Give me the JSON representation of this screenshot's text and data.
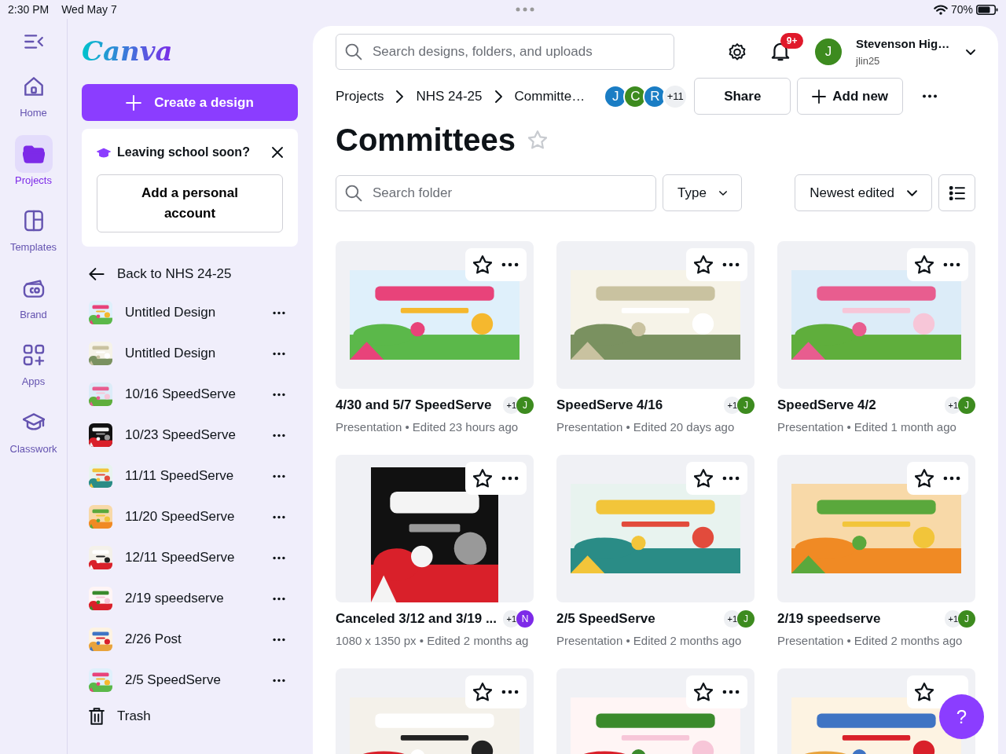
{
  "status_bar": {
    "time": "2:30 PM",
    "date": "Wed May 7",
    "battery": "70%"
  },
  "rail": {
    "items": [
      {
        "label": "Home",
        "selected": false
      },
      {
        "label": "Projects",
        "selected": true
      },
      {
        "label": "Templates",
        "selected": false
      },
      {
        "label": "Brand",
        "selected": false
      },
      {
        "label": "Apps",
        "selected": false
      },
      {
        "label": "Classwork",
        "selected": false
      }
    ]
  },
  "sidebar": {
    "logo": "Canva",
    "create_button": "Create a design",
    "promo": {
      "title": "Leaving school soon?",
      "button": "Add a personal account"
    },
    "back_link": "Back to NHS 24-25",
    "items": [
      {
        "name": "Untitled Design"
      },
      {
        "name": "Untitled Design"
      },
      {
        "name": "10/16 SpeedServe"
      },
      {
        "name": "10/23 SpeedServe"
      },
      {
        "name": "11/11 SpeedServe"
      },
      {
        "name": "11/20 SpeedServe"
      },
      {
        "name": "12/11 SpeedServe"
      },
      {
        "name": "2/19 speedserve"
      },
      {
        "name": "2/26 Post"
      },
      {
        "name": "2/5 SpeedServe"
      }
    ],
    "trash": "Trash"
  },
  "header": {
    "search": {
      "placeholder": "Search designs, folders, and uploads"
    },
    "notifications": "9+",
    "user": {
      "name": "Stevenson Hig…",
      "handle": "jlin25",
      "initial": "J"
    }
  },
  "breadcrumbs": [
    "Projects",
    "NHS 24-25",
    "Committe…"
  ],
  "collaborators": [
    {
      "initial": "J",
      "color": "#1a7dc4"
    },
    {
      "initial": "C",
      "color": "#3d8b1f"
    },
    {
      "initial": "R",
      "color": "#1a7dc4"
    }
  ],
  "collaborators_more": "+11",
  "actions": {
    "share": "Share",
    "add_new": "Add new"
  },
  "title": "Committees",
  "starred": false,
  "filters": {
    "search_placeholder": "Search folder",
    "type": "Type",
    "sort": "Newest edited"
  },
  "designs": [
    {
      "kind": "design",
      "title": "4/30 and 5/7 SpeedServe",
      "meta": "Presentation • Edited 23 hours ago",
      "shared": "+1",
      "owner": {
        "initial": "J",
        "color": "#3d8b1f"
      }
    },
    {
      "kind": "design",
      "title": "SpeedServe 4/16",
      "meta": "Presentation • Edited 20 days ago",
      "shared": "+1",
      "owner": {
        "initial": "J",
        "color": "#3d8b1f"
      }
    },
    {
      "kind": "design",
      "title": "SpeedServe 4/2",
      "meta": "Presentation • Edited 1 month ago",
      "shared": "+1",
      "owner": {
        "initial": "J",
        "color": "#3d8b1f"
      }
    },
    {
      "kind": "design",
      "title": "Canceled 3/12 and 3/19 ...",
      "meta": "1080 x 1350 px • Edited 2 months ag",
      "shared": "+1",
      "owner": {
        "initial": "N",
        "color": "#7d2ae8"
      }
    },
    {
      "kind": "design",
      "title": "2/5 SpeedServe",
      "meta": "Presentation • Edited 2 months ago",
      "shared": "+1",
      "owner": {
        "initial": "J",
        "color": "#3d8b1f"
      }
    },
    {
      "kind": "design",
      "title": "2/19 speedserve",
      "meta": "Presentation • Edited 2 months ago",
      "shared": "+1",
      "owner": {
        "initial": "J",
        "color": "#3d8b1f"
      }
    },
    {
      "kind": "picture"
    },
    {
      "kind": "picture"
    },
    {
      "kind": "picture"
    }
  ],
  "help": "?"
}
